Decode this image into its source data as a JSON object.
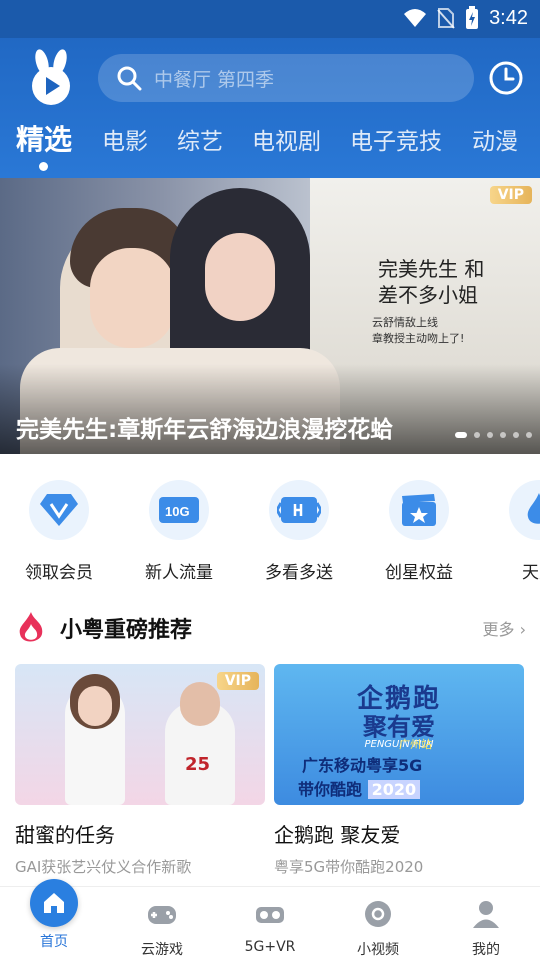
{
  "status_bar": {
    "time": "3:42"
  },
  "header": {
    "search_placeholder": "中餐厅 第四季",
    "tabs": [
      {
        "label": "精选",
        "active": true
      },
      {
        "label": "电影"
      },
      {
        "label": "综艺"
      },
      {
        "label": "电视剧"
      },
      {
        "label": "电子竞技"
      },
      {
        "label": "动漫"
      }
    ]
  },
  "banner": {
    "badge": "VIP",
    "caption": "完美先生:章斯年云舒海边浪漫挖花蛤",
    "poster_title": "完美先生 和 差不多小姐",
    "poster_sub_1": "云舒情敌上线",
    "poster_sub_2": "章教授主动吻上了!"
  },
  "quick_items": [
    {
      "label": "领取会员",
      "icon": "diamond-v-icon"
    },
    {
      "label": "新人流量",
      "icon": "data-10g-icon",
      "icon_text": "10G"
    },
    {
      "label": "多看多送",
      "icon": "gift-card-icon"
    },
    {
      "label": "创星权益",
      "icon": "clapper-star-icon"
    },
    {
      "label": "天天",
      "icon": "flame-icon"
    }
  ],
  "section": {
    "title": "小粤重磅推荐",
    "more": "更多"
  },
  "cards": [
    {
      "title": "甜蜜的任务",
      "subtitle": "GAI获张艺兴仗义合作新歌",
      "badge": "VIP",
      "jersey": "25"
    },
    {
      "title": "企鹅跑 聚友爱",
      "subtitle": "粤享5G带你酷跑2020",
      "poster_line1": "企鹅跑",
      "poster_line2": "聚有爱",
      "poster_en": "PENGUIN FUN",
      "poster_city": "广州站",
      "poster_line3": "广东移动粤享5G",
      "poster_line4": "带你酷跑",
      "poster_year": "2020"
    }
  ],
  "bottom_nav": [
    {
      "label": "首页",
      "active": true
    },
    {
      "label": "云游戏"
    },
    {
      "label": "5G+VR"
    },
    {
      "label": "小视频"
    },
    {
      "label": "我的"
    }
  ],
  "colors": {
    "primary": "#2a76d8",
    "header": "#1e64bf",
    "vip": "#e6b45a"
  }
}
